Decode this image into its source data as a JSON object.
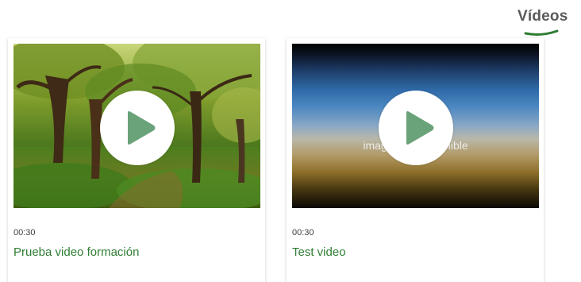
{
  "section": {
    "title": "Vídeos"
  },
  "colors": {
    "accent": "#2e7d32",
    "play": "#6aa279"
  },
  "videos": [
    {
      "duration": "00:30",
      "title": "Prueba video formación",
      "thumb_icon": "forest-thumbnail",
      "action_icon": "play-icon"
    },
    {
      "duration": "00:30",
      "title": "Test video",
      "thumb_icon": "image-unavailable-thumbnail",
      "thumb_text": "imagen no disponible",
      "action_icon": "play-icon"
    }
  ]
}
